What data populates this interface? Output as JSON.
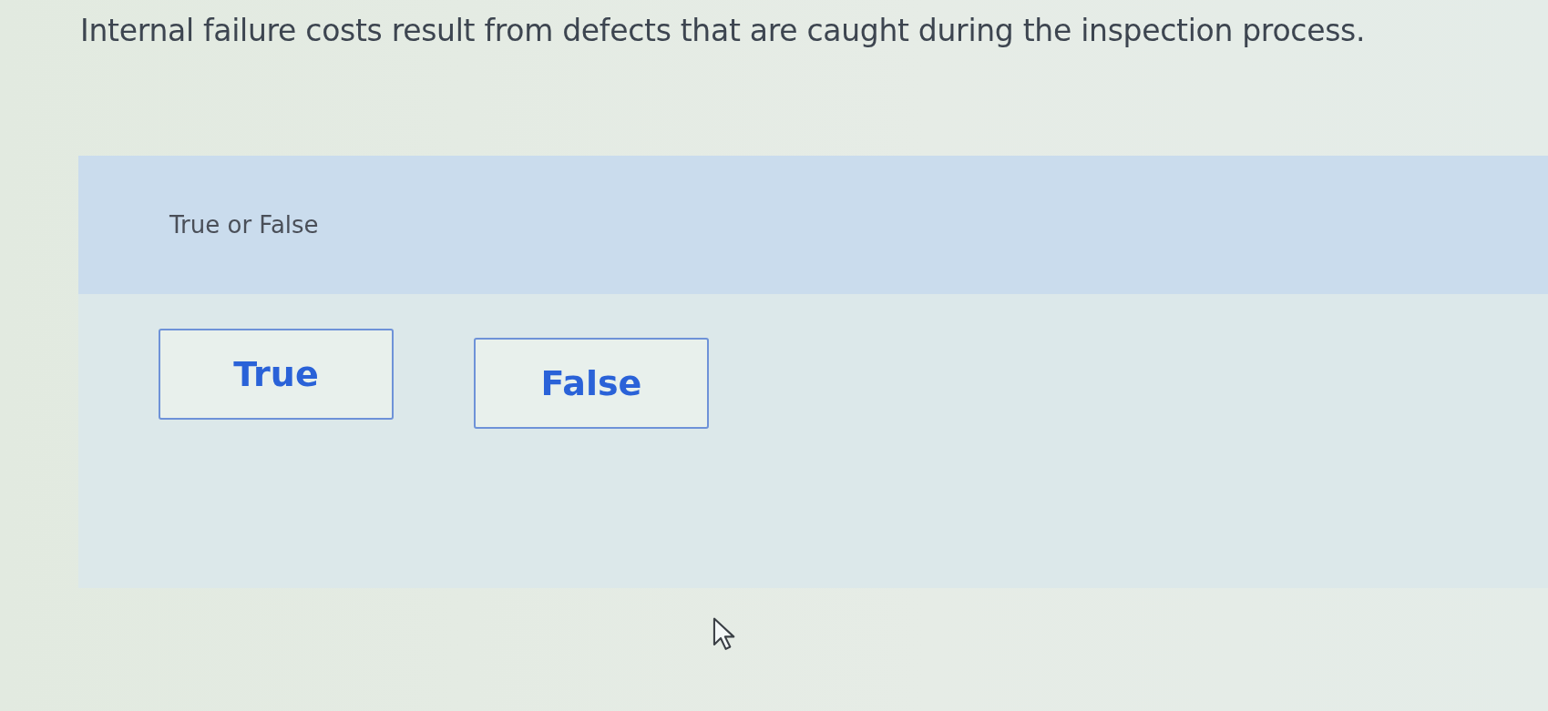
{
  "question": {
    "text": "Internal failure costs result from defects that are caught during the inspection process."
  },
  "answer_area": {
    "prompt": "True or False",
    "options": [
      {
        "label": "True",
        "selected": false
      },
      {
        "label": "False",
        "selected": false
      }
    ]
  }
}
